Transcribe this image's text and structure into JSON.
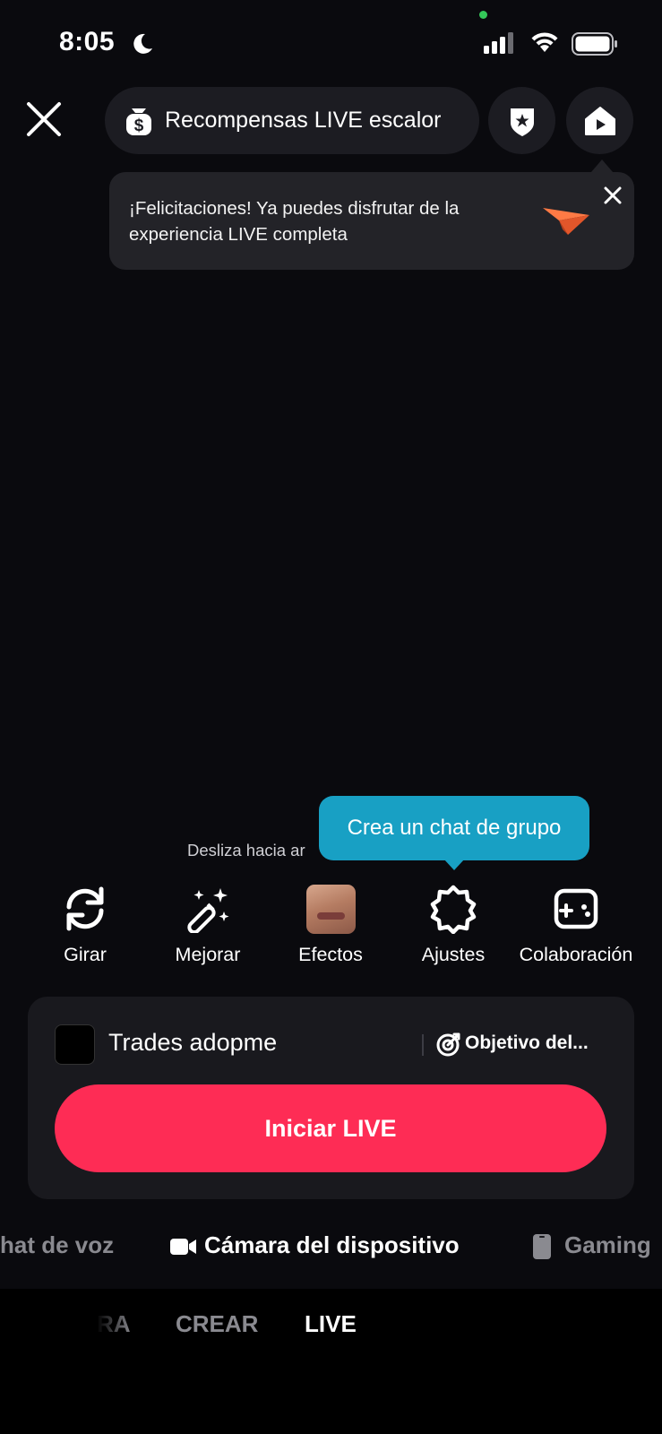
{
  "status_bar": {
    "time": "8:05"
  },
  "top_bar": {
    "rewards_label": "Recompensas LIVE escalor"
  },
  "toast": {
    "message": "¡Felicitaciones! Ya puedes disfrutar de la experiencia LIVE completa"
  },
  "tooltip": {
    "text": "Crea un chat de grupo"
  },
  "swipe_hint": "Desliza hacia ar",
  "tools": [
    {
      "label": "Girar",
      "icon": "rotate-icon"
    },
    {
      "label": "Mejorar",
      "icon": "magic-wand-icon"
    },
    {
      "label": "Efectos",
      "icon": "effects-thumbnail"
    },
    {
      "label": "Ajustes",
      "icon": "settings-gear-icon"
    },
    {
      "label": "Colaboración",
      "icon": "gamepad-icon"
    }
  ],
  "live_card": {
    "title": "Trades adopme",
    "goal_label": "Objetivo del...",
    "start_button": "Iniciar LIVE"
  },
  "source_options": [
    {
      "label": "hat de voz",
      "active": false
    },
    {
      "label": "Cámara del dispositivo",
      "active": true
    },
    {
      "label": "Gaming",
      "active": false
    }
  ],
  "modes": [
    {
      "label": "RA",
      "active": false
    },
    {
      "label": "CREAR",
      "active": false
    },
    {
      "label": "LIVE",
      "active": true
    }
  ],
  "colors": {
    "accent": "#fe2c55",
    "tooltip": "#18a0c4",
    "background": "#0a0a0e"
  }
}
